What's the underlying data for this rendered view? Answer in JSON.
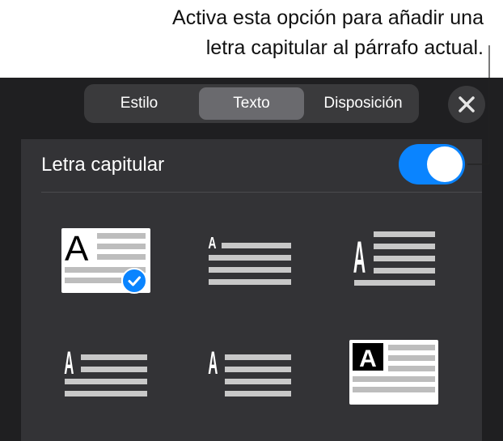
{
  "callout": {
    "line1": "Activa esta opción para añadir una",
    "line2": "letra capitular al párrafo actual."
  },
  "tabs": [
    {
      "label": "Estilo",
      "selected": false
    },
    {
      "label": "Texto",
      "selected": true
    },
    {
      "label": "Disposición",
      "selected": false
    }
  ],
  "close_icon": "close-icon",
  "drop_cap": {
    "label": "Letra capitular",
    "toggle_on": true,
    "accent_color": "#0a84ff"
  },
  "styles": [
    {
      "letter": "A",
      "selected": true
    },
    {
      "letter": "A",
      "selected": false
    },
    {
      "letter": "A",
      "selected": false
    },
    {
      "letter": "A",
      "selected": false
    },
    {
      "letter": "A",
      "selected": false
    },
    {
      "letter": "A",
      "selected": false
    }
  ]
}
